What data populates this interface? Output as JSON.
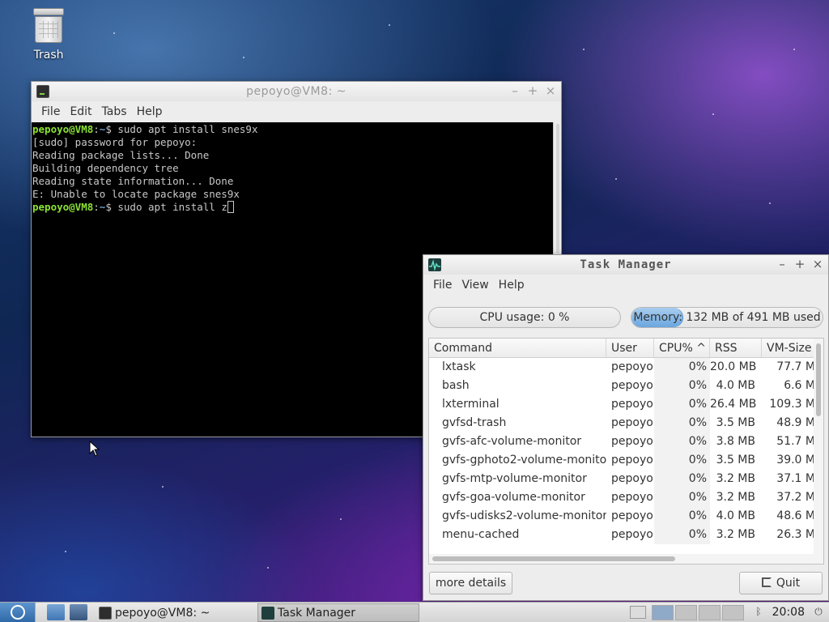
{
  "desktop": {
    "trash_label": "Trash"
  },
  "terminal": {
    "title": "pepoyo@VM8: ~",
    "menu": [
      "File",
      "Edit",
      "Tabs",
      "Help"
    ],
    "prompt_user": "pepoyo@VM8",
    "prompt_sep": ":",
    "prompt_path": "~",
    "prompt_dollar": "$",
    "lines": {
      "cmd1": " sudo apt install snes9x",
      "out1": "[sudo] password for pepoyo:",
      "out2": "Reading package lists... Done",
      "out3": "Building dependency tree",
      "out4": "Reading state information... Done",
      "out5": "E: Unable to locate package snes9x",
      "cmd2": " sudo apt install z"
    }
  },
  "taskmgr": {
    "title": "Task Manager",
    "menu": [
      "File",
      "View",
      "Help"
    ],
    "cpu_text": "CPU usage: 0 %",
    "memory_text": "Memory: 132 MB of 491 MB used",
    "memory_fraction": 0.27,
    "columns": [
      "Command",
      "User",
      "CPU% ^",
      "RSS",
      "VM-Size"
    ],
    "rows": [
      {
        "cmd": "lxtask",
        "user": "pepoyo",
        "cpu": "0%",
        "rss": "20.0 MB",
        "vm": "77.7 M"
      },
      {
        "cmd": "bash",
        "user": "pepoyo",
        "cpu": "0%",
        "rss": "4.0 MB",
        "vm": "6.6 M"
      },
      {
        "cmd": "lxterminal",
        "user": "pepoyo",
        "cpu": "0%",
        "rss": "26.4 MB",
        "vm": "109.3 M"
      },
      {
        "cmd": "gvfsd-trash",
        "user": "pepoyo",
        "cpu": "0%",
        "rss": "3.5 MB",
        "vm": "48.9 M"
      },
      {
        "cmd": "gvfs-afc-volume-monitor",
        "user": "pepoyo",
        "cpu": "0%",
        "rss": "3.8 MB",
        "vm": "51.7 M"
      },
      {
        "cmd": "gvfs-gphoto2-volume-monitor",
        "user": "pepoyo",
        "cpu": "0%",
        "rss": "3.5 MB",
        "vm": "39.0 M"
      },
      {
        "cmd": "gvfs-mtp-volume-monitor",
        "user": "pepoyo",
        "cpu": "0%",
        "rss": "3.2 MB",
        "vm": "37.1 M"
      },
      {
        "cmd": "gvfs-goa-volume-monitor",
        "user": "pepoyo",
        "cpu": "0%",
        "rss": "3.2 MB",
        "vm": "37.2 M"
      },
      {
        "cmd": "gvfs-udisks2-volume-monitor",
        "user": "pepoyo",
        "cpu": "0%",
        "rss": "4.0 MB",
        "vm": "48.6 M"
      },
      {
        "cmd": "menu-cached",
        "user": "pepoyo",
        "cpu": "0%",
        "rss": "3.2 MB",
        "vm": "26.3 M"
      }
    ],
    "more_details_label": "more details",
    "quit_label": "Quit"
  },
  "taskbar": {
    "tasks": [
      {
        "label": "pepoyo@VM8: ~"
      },
      {
        "label": "Task Manager"
      }
    ],
    "clock": "20:08"
  },
  "colors": {
    "prompt_user": "#8ae234",
    "prompt_path": "#729fcf",
    "memory_fill": "#6aa6df"
  }
}
